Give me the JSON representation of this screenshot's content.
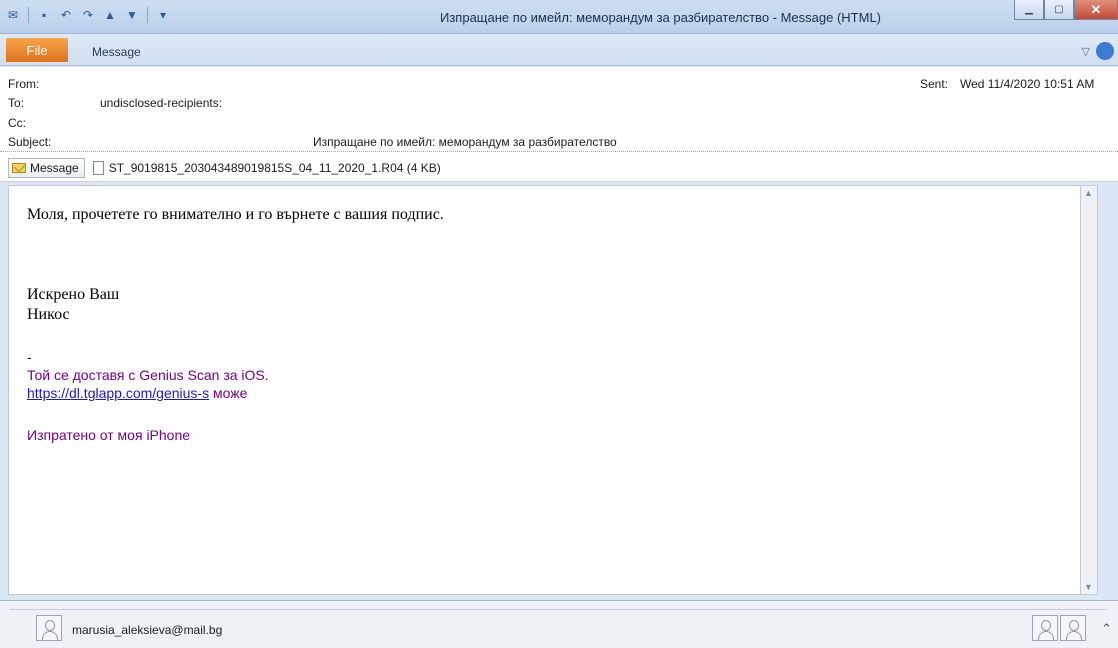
{
  "window": {
    "title": "Изпращане по имейл: меморандум за разбирателство  -  Message (HTML)"
  },
  "ribbon": {
    "file_tab": "File",
    "message_tab": "Message"
  },
  "header": {
    "from_label": "From:",
    "from_value": "",
    "to_label": "To:",
    "to_value": "undisclosed-recipients:",
    "cc_label": "Cc:",
    "subject_label": "Subject:",
    "subject_value": "Изпращане по имейл: меморандум за разбирателство",
    "sent_label": "Sent:",
    "sent_value": "Wed 11/4/2020 10:51 AM"
  },
  "attachments": {
    "message_label": "Message",
    "file_name": "ST_9019815_203043489019815S_04_11_2020_1.R04 (4 KB)"
  },
  "body": {
    "line1": "Моля, прочетете го внимателно и го върнете с вашия подпис.",
    "closing1": "Искрено Ваш",
    "closing2": "Никос",
    "dash": "-",
    "delivered": "Той се доставя с Genius Scan за iOS.",
    "link": "https://dl.tglapp.com/genius-s",
    "link_suffix": " може",
    "sent_from": "Изпратено от моя iPhone"
  },
  "people": {
    "email": "marusia_aleksieva@mail.bg"
  },
  "colors": {
    "accent_file_tab": "#e0711b",
    "signature_text": "#7b008b",
    "link": "#1a1acc"
  }
}
